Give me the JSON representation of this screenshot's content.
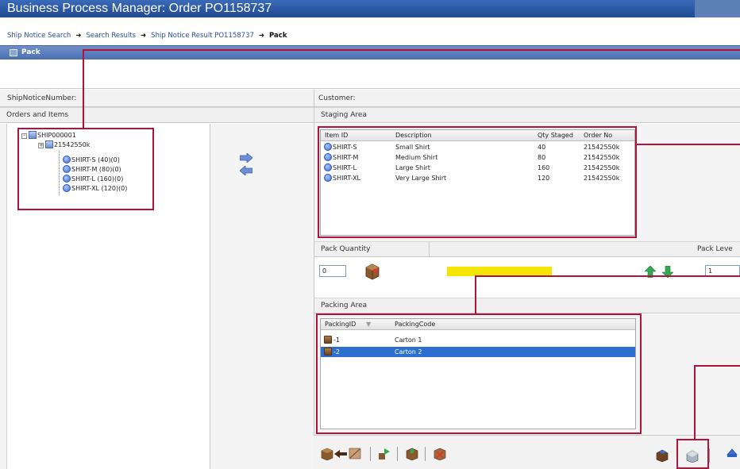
{
  "window": {
    "title": "Business Process Manager: Order PO1158737"
  },
  "breadcrumb": {
    "items": [
      "Ship Notice Search",
      "Search Results",
      "Ship Notice Result PO1158737"
    ],
    "current": "Pack",
    "separator": "➜"
  },
  "pack_bar": {
    "label": "Pack"
  },
  "fields": {
    "ship_notice_label": "ShipNoticeNumber:",
    "customer_label": "Customer:"
  },
  "orders_panel": {
    "title": "Orders and Items",
    "tree": {
      "root": "SHIP000001",
      "order": "21542550k",
      "items": [
        "SHIRT-S (40)(0)",
        "SHIRT-M (80)(0)",
        "SHIRT-L (160)(0)",
        "SHIRT-XL (120)(0)"
      ]
    }
  },
  "staging": {
    "title": "Staging Area",
    "columns": [
      "Item ID",
      "Description",
      "Qty Staged",
      "Order No"
    ],
    "rows": [
      {
        "item_id": "SHIRT-S",
        "description": "Small Shirt",
        "qty": "40",
        "order_no": "21542550k"
      },
      {
        "item_id": "SHIRT-M",
        "description": "Medium Shirt",
        "qty": "80",
        "order_no": "21542550k"
      },
      {
        "item_id": "SHIRT-L",
        "description": "Large Shirt",
        "qty": "160",
        "order_no": "21542550k"
      },
      {
        "item_id": "SHIRT-XL",
        "description": "Very Large Shirt",
        "qty": "120",
        "order_no": "21542550k"
      }
    ]
  },
  "pack_quantity": {
    "title": "Pack Quantity",
    "value": "0",
    "level_title": "Pack Leve",
    "level_value": "1"
  },
  "packing": {
    "title": "Packing Area",
    "columns": [
      "PackingID",
      "PackingCode"
    ],
    "rows": [
      {
        "id": "-1",
        "code": "Carton 1",
        "selected": false
      },
      {
        "id": "-2",
        "code": "Carton 2",
        "selected": true
      }
    ]
  },
  "colors": {
    "title_bar": "#2a57a4",
    "annotation": "#b3123a",
    "selection": "#2c6fd1",
    "progress": "#f6e500"
  }
}
